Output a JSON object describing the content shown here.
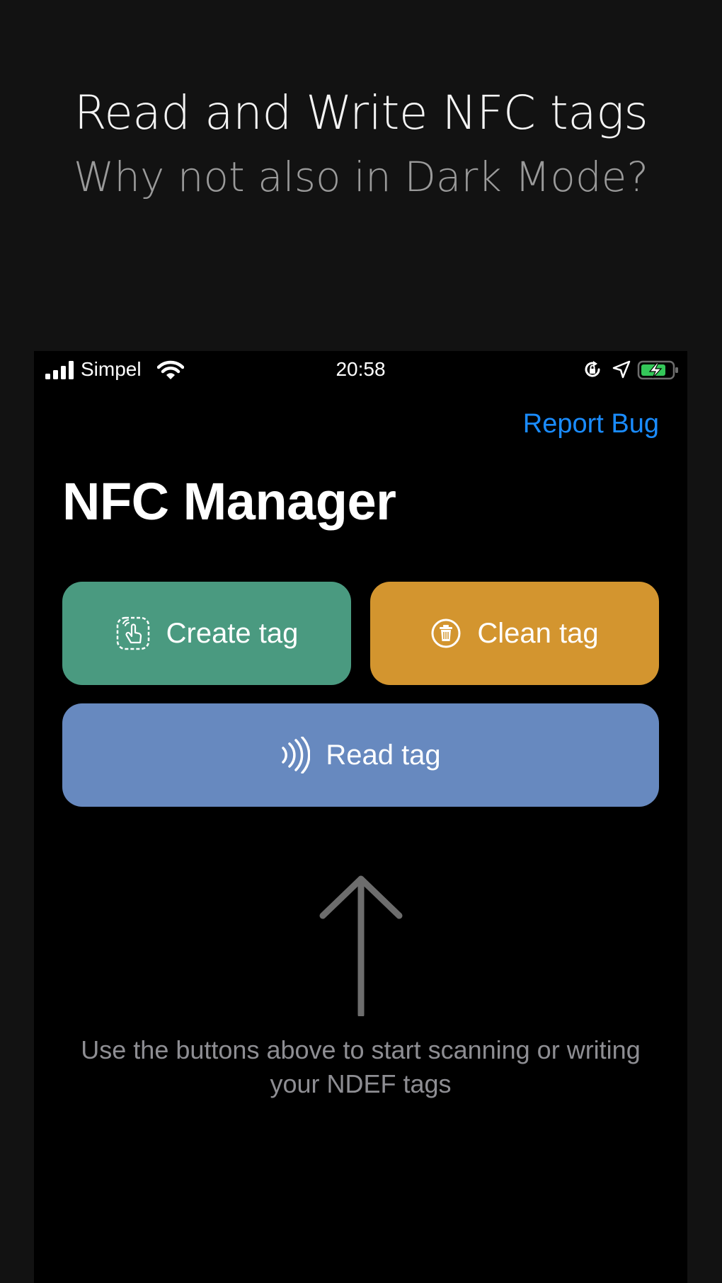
{
  "promo": {
    "title": "Read and Write NFC tags",
    "subtitle": "Why not also in Dark Mode?"
  },
  "status_bar": {
    "carrier": "Simpel",
    "time": "20:58",
    "icons": [
      "signal-icon",
      "wifi-icon",
      "rotation-lock-icon",
      "location-icon",
      "battery-charging-icon"
    ]
  },
  "header": {
    "report_bug_label": "Report Bug",
    "title": "NFC Manager"
  },
  "actions": {
    "create": {
      "label": "Create tag",
      "icon": "tap-hand-icon",
      "color": "#4a9a80"
    },
    "clean": {
      "label": "Clean tag",
      "icon": "trash-icon",
      "color": "#d3952f"
    },
    "read": {
      "label": "Read tag",
      "icon": "nfc-waves-icon",
      "color": "#6789bf"
    }
  },
  "hint": {
    "text": "Use the buttons above to start scanning or writing your NDEF tags",
    "arrow_icon": "arrow-up-icon"
  },
  "colors": {
    "background": "#121212",
    "screen": "#000000",
    "link": "#1a8cff",
    "muted_text": "#8e8e93"
  }
}
